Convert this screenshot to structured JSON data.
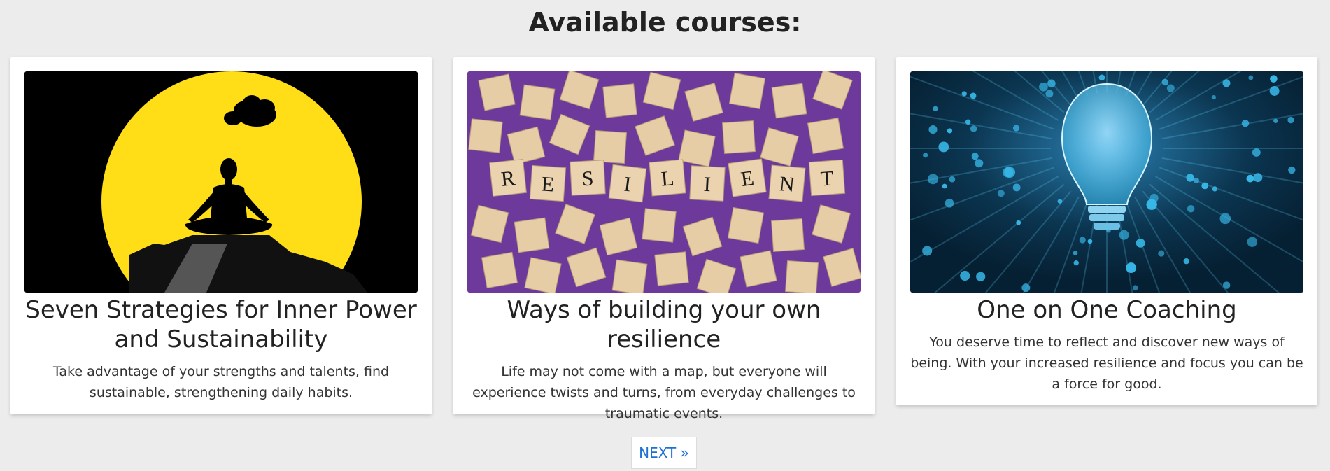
{
  "page": {
    "title": "Available courses:"
  },
  "courses": [
    {
      "title": "Seven Strategies for Inner Power and Sustainability",
      "description": "Take advantage of your strengths and talents, find sustainable, strengthening daily habits.",
      "image_icon": "meditation-silhouette-icon"
    },
    {
      "title": "Ways of building your own resilience",
      "description": "Life may not come with a map, but everyone will experience twists and turns, from everyday challenges to traumatic events.",
      "image_icon": "resilient-tiles-icon",
      "image_tiles": [
        "R",
        "E",
        "S",
        "I",
        "L",
        "I",
        "E",
        "N",
        "T"
      ]
    },
    {
      "title": "One on One Coaching",
      "description": "You deserve time to reflect and discover new ways of being. With your increased resilience and focus you can be a force for good.",
      "image_icon": "lightbulb-icon"
    }
  ],
  "pagination": {
    "next_label": "NEXT »"
  },
  "colors": {
    "background": "#ececec",
    "card": "#ffffff",
    "link": "#1e6fd6",
    "moon": "#ffde17",
    "tile_background": "#6d3a9c",
    "bulb_background": "#062033",
    "bulb_glow": "#38b8e8"
  }
}
